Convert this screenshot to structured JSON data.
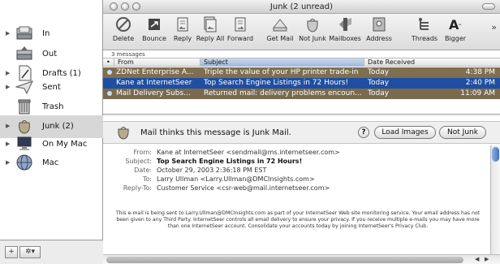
{
  "window": {
    "title": "Junk (2 unread)"
  },
  "sidebar": {
    "mailboxes": [
      {
        "label": "In",
        "icon": "inbox-tray-icon"
      },
      {
        "label": "Out",
        "icon": "outbox-tray-icon"
      },
      {
        "label": "Drafts (1)",
        "icon": "drafts-page-icon"
      },
      {
        "label": "Sent",
        "icon": "sent-plane-icon"
      },
      {
        "label": "Trash",
        "icon": "trash-can-icon"
      },
      {
        "label": "Junk (2)",
        "icon": "junk-bag-icon"
      },
      {
        "label": "On My Mac",
        "icon": "computer-icon"
      },
      {
        "label": "Mac",
        "icon": "dot-mac-globe-icon"
      }
    ],
    "selected": "Junk (2)",
    "add_button": "+",
    "action_button": "✲▾"
  },
  "toolbar": {
    "items": [
      {
        "label": "Delete",
        "icon": "delete-icon"
      },
      {
        "label": "Bounce",
        "icon": "bounce-icon"
      },
      {
        "label": "Reply",
        "icon": "reply-icon"
      },
      {
        "label": "Reply All",
        "icon": "reply-all-icon"
      },
      {
        "label": "Forward",
        "icon": "forward-icon"
      },
      {
        "label": "Get Mail",
        "icon": "get-mail-icon"
      },
      {
        "label": "Not Junk",
        "icon": "not-junk-icon"
      },
      {
        "label": "Mailboxes",
        "icon": "mailboxes-icon"
      },
      {
        "label": "Address",
        "icon": "address-book-icon"
      },
      {
        "label": "Threads",
        "icon": "threads-icon"
      },
      {
        "label": "Bigger",
        "icon": "bigger-font-icon"
      }
    ],
    "more": "»"
  },
  "message_list": {
    "count_text": "3 messages",
    "columns": {
      "from": "From",
      "subject": "Subject",
      "date": "Date Received"
    },
    "rows": [
      {
        "from": "ZDNet Enterprise A...",
        "subject": "Triple the value of your HP printer trade-in",
        "date": "Today",
        "time": "4:38 PM",
        "unread": true,
        "selected": false
      },
      {
        "from": "Kane at InternetSeer",
        "subject": "Top Search Engine Listings in 72 Hours!",
        "date": "Today",
        "time": "2:40 PM",
        "unread": false,
        "selected": true
      },
      {
        "from": "Mail Delivery Subs...",
        "subject": "Returned mail: delivery problems encoun...",
        "date": "Today",
        "time": "11:09 AM",
        "unread": true,
        "selected": false
      }
    ],
    "colors": {
      "junk_row": "#7f6e50",
      "selected_row": "#1e4fa3"
    }
  },
  "preview": {
    "junk_notice": "Mail thinks this message is Junk Mail.",
    "help_button": "?",
    "load_images_button": "Load Images",
    "not_junk_button": "Not Junk",
    "headers": [
      {
        "key": "From:",
        "value": "Kane at InternetSeer <sendmail@ms.internetseer.com>",
        "bold": false
      },
      {
        "key": "Subject:",
        "value": "Top Search Engine Listings in 72 Hours!",
        "bold": true
      },
      {
        "key": "Date:",
        "value": "October 29, 2003 2:36:18 PM EST",
        "bold": false
      },
      {
        "key": "To:",
        "value": "Larry Ullman <Larry.Ullman@DMCInsights.com>",
        "bold": false
      },
      {
        "key": "Reply-To:",
        "value": "Customer Service <csr-web@mail.internetseer.com>",
        "bold": false
      }
    ],
    "body": "This e-mail is being sent to Larry.Ullman@DMCInsights.com as part of your InternetSeer Web site monitoring service. Your email address has not been given to any Third Party. InternetSeer controls all email delivery to ensure your privacy. If you receive multiple e-mails you may have more than one InternetSeer account. Consolidate your accounts today by joining InternetSeer's Privacy Club."
  }
}
